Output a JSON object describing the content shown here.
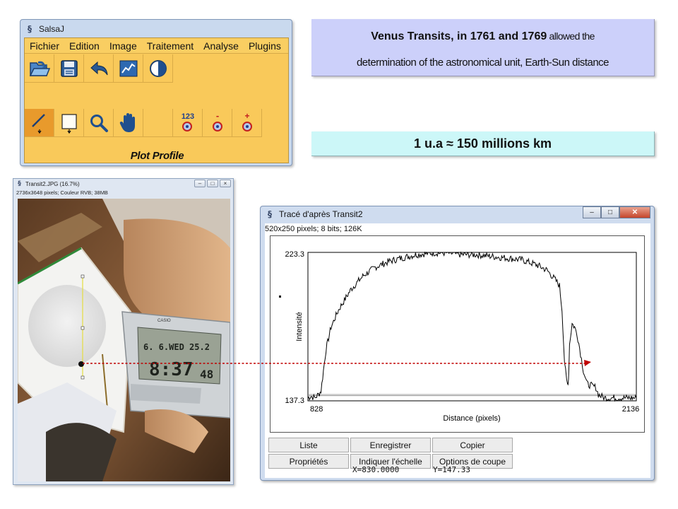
{
  "salsaj": {
    "title": "SalsaJ",
    "menu": [
      "Fichier",
      "Edition",
      "Image",
      "Traitement",
      "Analyse",
      "Plugins"
    ],
    "toolbar1_icons": [
      "open-icon",
      "save-icon",
      "undo-icon",
      "chart-icon",
      "contrast-icon"
    ],
    "toolbar2_icons": [
      "line-tool-icon",
      "rectangle-tool-icon",
      "magnifier-icon",
      "hand-icon",
      "blank",
      "counter-123-icon",
      "minus-target-icon",
      "plus-target-icon"
    ],
    "counter_text": "123",
    "minus_text": "-",
    "plus_text": "+",
    "status": "Plot Profile"
  },
  "venus_box": {
    "line1_bold": "Venus Transits,  in 1761 and 1769",
    "line1_rest": " allowed the",
    "line2": "determination of the astronomical unit, Earth-Sun distance"
  },
  "au_box": {
    "text": "1 u.a ≈ 150 millions km"
  },
  "image_window": {
    "title": "Transit2.JPG (16.7%)",
    "info": "2736x3648 pixels; Couleur RVB; 38MB",
    "clock_date": "6. 6.WED 25.2",
    "clock_time": "8:37",
    "clock_seconds": "48",
    "clock_brand": "CASIO"
  },
  "profile_window": {
    "title": "Tracé d'après Transit2",
    "info": "520x250 pixels; 8 bits; 126K",
    "buttons": [
      "Liste",
      "Enregistrer",
      "Copier",
      "Propriétés",
      "Indiquer l'échelle",
      "Options de coupe"
    ],
    "x_readout": "X=830.0000",
    "y_readout": "Y=147.33"
  },
  "chart_data": {
    "type": "line",
    "xlabel": "Distance (pixels)",
    "ylabel": "Intensité",
    "x_tick_labels": [
      "828",
      "2136"
    ],
    "y_tick_labels": [
      "223.3",
      "137.3"
    ],
    "xlim": [
      828,
      2136
    ],
    "ylim": [
      137.3,
      223.3
    ],
    "grid": false,
    "series": [
      {
        "x": [
          828,
          840,
          855,
          870,
          880,
          900,
          920,
          950,
          1000,
          1050,
          1100,
          1150,
          1200,
          1260,
          1320,
          1380,
          1440,
          1500,
          1560,
          1620,
          1680,
          1740,
          1780,
          1810,
          1830,
          1840,
          1850,
          1858,
          1862,
          1866,
          1870,
          1880,
          1890,
          1900,
          1910,
          1925,
          1940,
          1960,
          1975,
          1985,
          1995,
          2010,
          2040,
          2080,
          2136
        ],
        "y": [
          139,
          140,
          139,
          141,
          143,
          167,
          180,
          190,
          202,
          210,
          215,
          218,
          220,
          222,
          223,
          223,
          222,
          222,
          221,
          220,
          219,
          216,
          213,
          208,
          204,
          190,
          160,
          149,
          147,
          150,
          170,
          182,
          180,
          176,
          168,
          155,
          147,
          146,
          145,
          141,
          140,
          139,
          139,
          139,
          139
        ],
        "color": "#000000"
      }
    ],
    "reference_lines_y": [
      141,
      140.3
    ],
    "marker": {
      "x": 830,
      "y": 147.33
    }
  },
  "annotation": {
    "arrow_color": "#c00000"
  }
}
